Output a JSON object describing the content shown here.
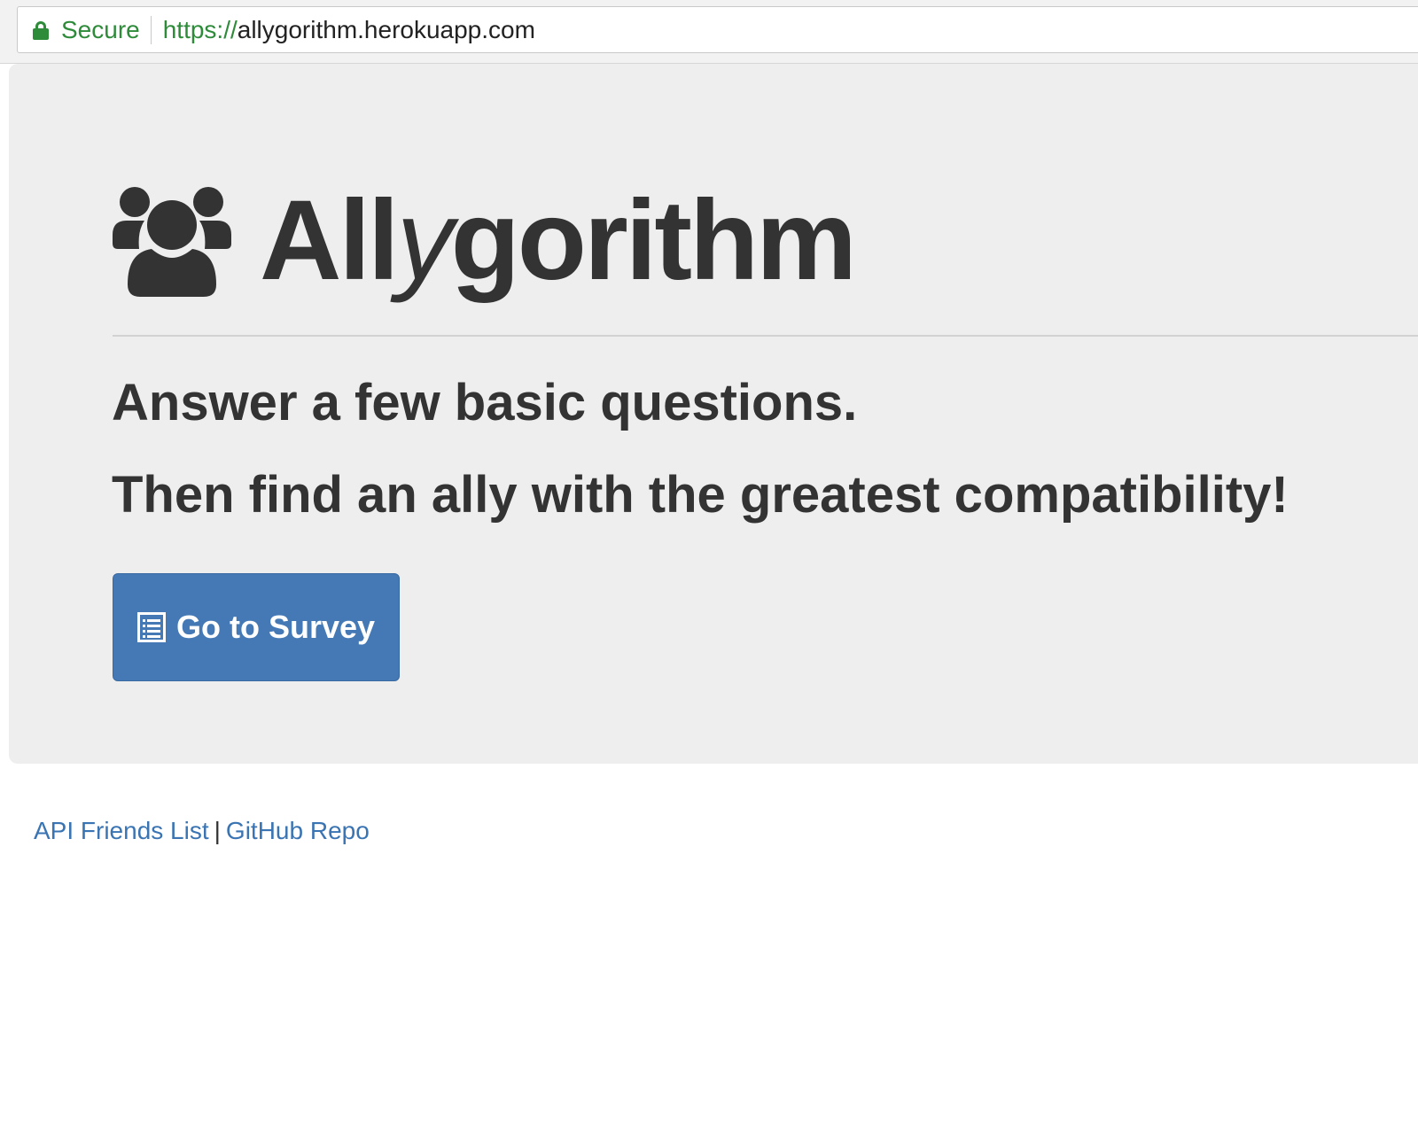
{
  "browser": {
    "secure_label": "Secure",
    "url_scheme": "https://",
    "url_host": "allygorithm.herokuapp.com",
    "secure_color": "#2e8b3a"
  },
  "jumbotron": {
    "icon": "users-icon",
    "brand_prefix": "All",
    "brand_italic": "y",
    "brand_suffix": "gorithm",
    "line1": "Answer a few basic questions.",
    "line2": "Then find an ally with the greatest compatibility!",
    "button_label": "Go to Survey",
    "button_icon": "list-alt-icon",
    "button_color": "#4479b5",
    "background": "#eeeeee"
  },
  "footer": {
    "link1": "API Friends List",
    "separator": "|",
    "link2": "GitHub Repo",
    "link_color": "#3a74b3"
  }
}
